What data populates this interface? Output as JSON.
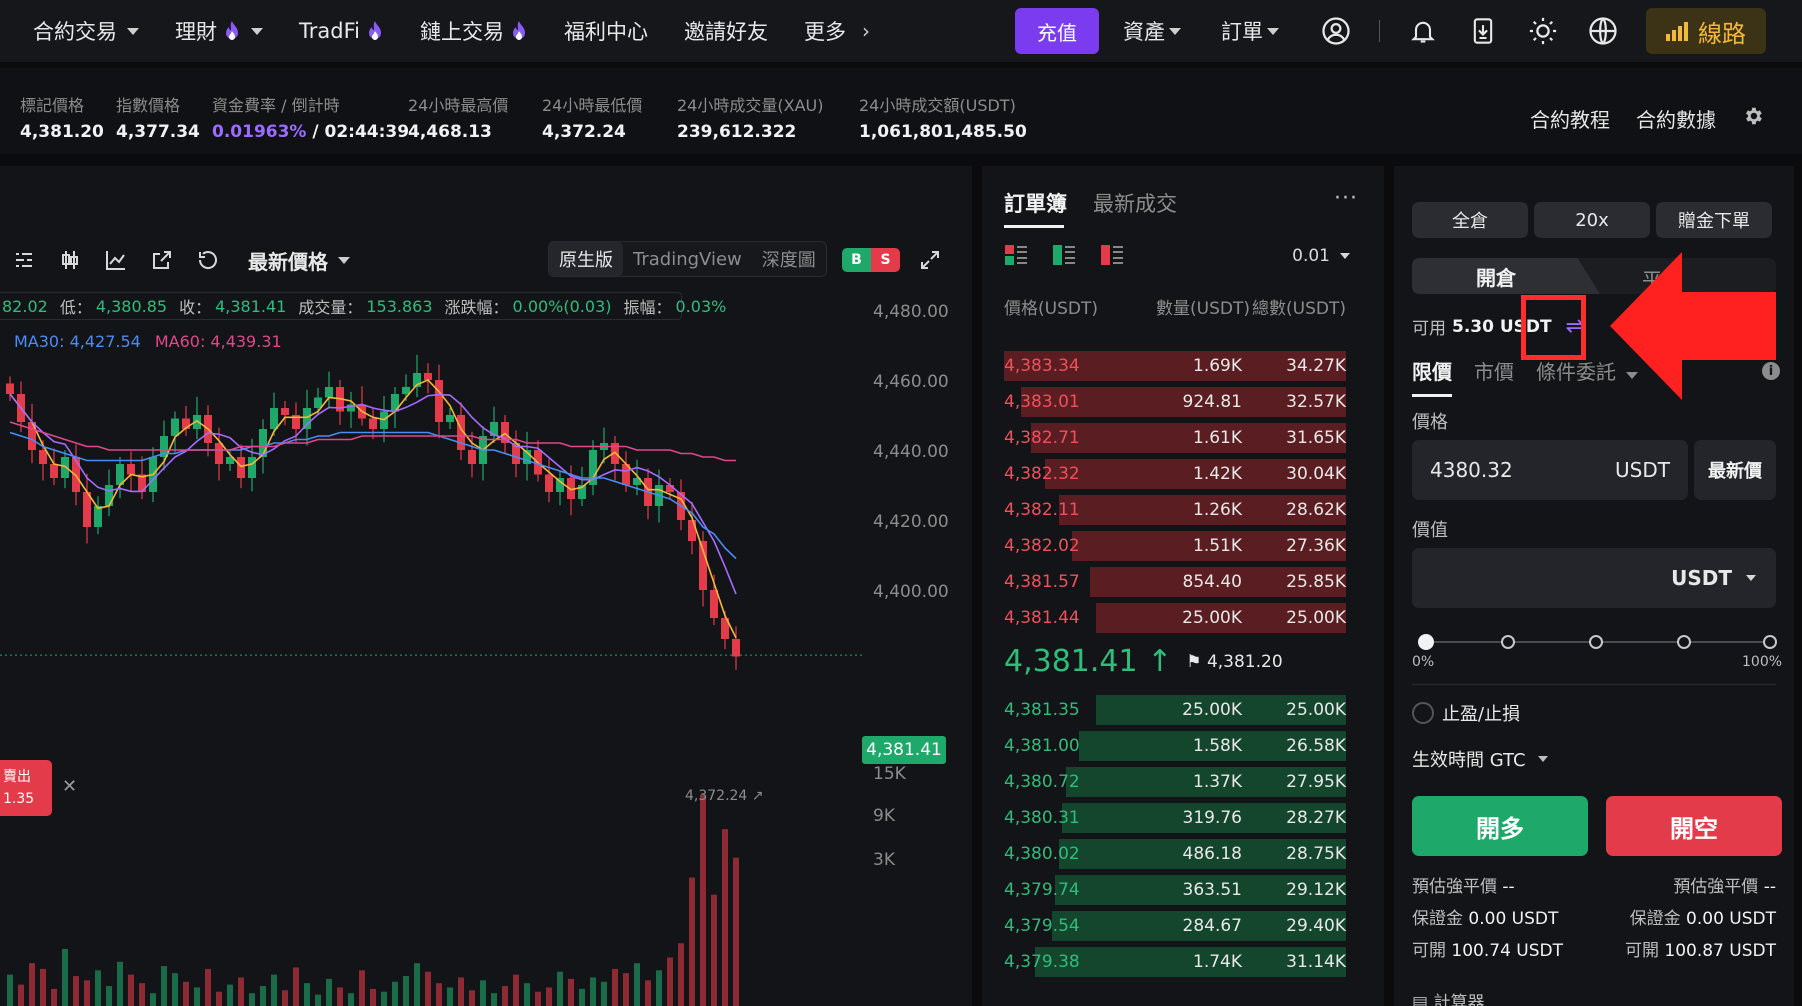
{
  "nav": {
    "items": [
      {
        "label": "合約交易",
        "dropdown": true,
        "fire": false
      },
      {
        "label": "理財",
        "dropdown": true,
        "fire": true
      },
      {
        "label": "TradFi",
        "dropdown": false,
        "fire": true
      },
      {
        "label": "鏈上交易",
        "dropdown": false,
        "fire": true
      },
      {
        "label": "福利中心",
        "dropdown": false,
        "fire": false
      },
      {
        "label": "邀請好友",
        "dropdown": false,
        "fire": false
      },
      {
        "label": "更多",
        "dropdown": false,
        "fire": false
      }
    ],
    "deposit": "充值",
    "assets": "資產",
    "orders": "訂單",
    "route": "線路",
    "icons": [
      "user-icon",
      "bell-icon",
      "download-icon",
      "sun-icon",
      "globe-icon"
    ]
  },
  "stats": {
    "mark_price": {
      "label": "標記價格",
      "value": "4,381.20"
    },
    "index_price": {
      "label": "指數價格",
      "value": "4,377.34"
    },
    "funding": {
      "label": "資金費率 / 倒計時",
      "rate": "0.01963%",
      "countdown": "/ 02:44:39"
    },
    "high24": {
      "label": "24小時最高價",
      "value": "4,468.13"
    },
    "low24": {
      "label": "24小時最低價",
      "value": "4,372.24"
    },
    "vol24": {
      "label": "24小時成交量(XAU)",
      "value": "239,612.322"
    },
    "turnover24": {
      "label": "24小時成交額(USDT)",
      "value": "1,061,801,485.50"
    },
    "tutorial": "合約教程",
    "data": "合約數據"
  },
  "chart": {
    "price_type": "最新價格",
    "versions": [
      "原生版",
      "TradingView",
      "深度圖"
    ],
    "active_version": 0,
    "bs_b": "B",
    "bs_s": "S",
    "ohlc": {
      "partial_high": "82.02",
      "low_label": "低：",
      "low": "4,380.85",
      "close_label": "收：",
      "close": "4,381.41",
      "vol_label": "成交量：",
      "vol": "153.863",
      "chg_label": "涨跌幅：",
      "chg": "0.00%(0.03)",
      "amp_label": "振幅：",
      "amp": "0.03%"
    },
    "ma30": "MA30: 4,427.54",
    "ma60": "MA60: 4,439.31",
    "y_labels": [
      "4,480.00",
      "4,460.00",
      "4,440.00",
      "4,420.00",
      "4,400.00"
    ],
    "vol_labels": [
      "15K",
      "9K",
      "3K"
    ],
    "last_price": "4,381.41",
    "low_marker": "4,372.24",
    "sell_tag": [
      "賣出",
      "1.35"
    ]
  },
  "chart_data": {
    "type": "candlestick",
    "ylim": [
      4372,
      4480
    ],
    "price_axis_ticks": [
      4480,
      4460,
      4440,
      4420,
      4400
    ],
    "volume_axis_ticks": [
      15000,
      9000,
      3000
    ],
    "last_price": 4381.41,
    "low": 4372.24,
    "close_series": [
      4456,
      4448,
      4440,
      4436,
      4432,
      4438,
      4428,
      4418,
      4424,
      4430,
      4436,
      4433,
      4428,
      4438,
      4444,
      4449,
      4446,
      4450,
      4442,
      4436,
      4438,
      4432,
      4438,
      4446,
      4452,
      4450,
      4446,
      4452,
      4455,
      4458,
      4451,
      4453,
      4449,
      4446,
      4451,
      4456,
      4458,
      4462,
      4460,
      4448,
      4450,
      4440,
      4436,
      4444,
      4448,
      4442,
      4436,
      4440,
      4433,
      4428,
      4432,
      4426,
      4430,
      4440,
      4442,
      4436,
      4430,
      4432,
      4424,
      4430,
      4428,
      4420,
      4414,
      4400,
      4392,
      4386,
      4381
    ],
    "ma30_series": [
      4445,
      4444,
      4443,
      4441,
      4440,
      4439,
      4438,
      4437,
      4437,
      4437,
      4437,
      4437,
      4437,
      4438,
      4439,
      4439,
      4440,
      4440,
      4440,
      4440,
      4440,
      4440,
      4441,
      4441,
      4442,
      4442,
      4443,
      4443,
      4444,
      4444,
      4445,
      4445,
      4445,
      4445,
      4445,
      4445,
      4445,
      4445,
      4445,
      4444,
      4443,
      4442,
      4441,
      4440,
      4440,
      4439,
      4438,
      4437,
      4436,
      4435,
      4434,
      4433,
      4432,
      4432,
      4432,
      4431,
      4430,
      4429,
      4428,
      4427,
      4426,
      4424,
      4422,
      4418,
      4416,
      4412,
      4409
    ],
    "ma60_series": [
      4448,
      4447,
      4446,
      4445,
      4444,
      4443,
      4442,
      4441,
      4441,
      4440,
      4440,
      4440,
      4440,
      4440,
      4440,
      4440,
      4440,
      4440,
      4440,
      4440,
      4440,
      4441,
      4441,
      4441,
      4441,
      4442,
      4442,
      4442,
      4443,
      4443,
      4443,
      4443,
      4444,
      4444,
      4444,
      4444,
      4444,
      4444,
      4444,
      4444,
      4444,
      4444,
      4444,
      4443,
      4443,
      4443,
      4443,
      4442,
      4442,
      4442,
      4442,
      4441,
      4441,
      4441,
      4441,
      4441,
      4441,
      4440,
      4440,
      4440,
      4440,
      4439,
      4439,
      4438,
      4438,
      4437,
      4437
    ],
    "volume_series": [
      2200,
      1500,
      3000,
      2600,
      1200,
      4000,
      2100,
      1800,
      2500,
      1400,
      3100,
      2200,
      1600,
      900,
      2800,
      2300,
      1700,
      1300,
      2600,
      1000,
      1500,
      2000,
      900,
      1400,
      2200,
      1100,
      2700,
      1600,
      800,
      1900,
      1300,
      900,
      2500,
      1200,
      1000,
      1700,
      2100,
      3000,
      2400,
      1600,
      1300,
      2000,
      1100,
      1800,
      900,
      1400,
      2200,
      1600,
      1000,
      1300,
      2400,
      1900,
      1200,
      2000,
      1700,
      2600,
      2300,
      3000,
      1800,
      2500,
      3400,
      4400,
      9000,
      14800,
      7800,
      12400,
      10400
    ]
  },
  "book": {
    "tabs": [
      "訂單簿",
      "最新成交"
    ],
    "more": "···",
    "tick": "0.01",
    "headers": [
      "價格(USDT)",
      "數量(USDT)",
      "總數(USDT)"
    ],
    "asks": [
      {
        "p": "4,383.34",
        "q": "1.69K",
        "t": "34.27K",
        "depth": 1.0
      },
      {
        "p": "4,383.01",
        "q": "924.81",
        "t": "32.57K",
        "depth": 0.95
      },
      {
        "p": "4,382.71",
        "q": "1.61K",
        "t": "31.65K",
        "depth": 0.92
      },
      {
        "p": "4,382.32",
        "q": "1.42K",
        "t": "30.04K",
        "depth": 0.88
      },
      {
        "p": "4,382.11",
        "q": "1.26K",
        "t": "28.62K",
        "depth": 0.84
      },
      {
        "p": "4,382.02",
        "q": "1.51K",
        "t": "27.36K",
        "depth": 0.8
      },
      {
        "p": "4,381.57",
        "q": "854.40",
        "t": "25.85K",
        "depth": 0.75
      },
      {
        "p": "4,381.44",
        "q": "25.00K",
        "t": "25.00K",
        "depth": 0.73
      }
    ],
    "mid_price": "4,381.41 ↑",
    "mark": "4,381.20",
    "bids": [
      {
        "p": "4,381.35",
        "q": "25.00K",
        "t": "25.00K",
        "depth": 0.73
      },
      {
        "p": "4,381.00",
        "q": "1.58K",
        "t": "26.58K",
        "depth": 0.78
      },
      {
        "p": "4,380.72",
        "q": "1.37K",
        "t": "27.95K",
        "depth": 0.82
      },
      {
        "p": "4,380.31",
        "q": "319.76",
        "t": "28.27K",
        "depth": 0.83
      },
      {
        "p": "4,380.02",
        "q": "486.18",
        "t": "28.75K",
        "depth": 0.84
      },
      {
        "p": "4,379.74",
        "q": "363.51",
        "t": "29.12K",
        "depth": 0.85
      },
      {
        "p": "4,379.54",
        "q": "284.67",
        "t": "29.40K",
        "depth": 0.86
      },
      {
        "p": "4,379.38",
        "q": "1.74K",
        "t": "31.14K",
        "depth": 0.91
      }
    ]
  },
  "trade": {
    "margin_mode": "全倉",
    "leverage": "20x",
    "bonus": "贈金下單",
    "open": "開倉",
    "close": "平倉",
    "avail_label": "可用",
    "avail_value": "5.30 USDT",
    "order_types": [
      "限價",
      "市價",
      "條件委託"
    ],
    "price_label": "價格",
    "price_value": "4380.32",
    "price_unit": "USDT",
    "latest": "最新價",
    "value_label": "價值",
    "value_unit": "USDT",
    "pct_min": "0%",
    "pct_max": "100%",
    "tpsl": "止盈/止損",
    "tif": "生效時間 GTC",
    "long": "開多",
    "short": "開空",
    "liq_label": "預估強平價",
    "liq_long": "--",
    "liq_short": "--",
    "margin_label": "保證金",
    "margin_long": "0.00 USDT",
    "margin_short": "0.00 USDT",
    "openable_label": "可開",
    "openable_long": "100.74 USDT",
    "openable_short": "100.87 USDT",
    "calc": "計算器"
  }
}
